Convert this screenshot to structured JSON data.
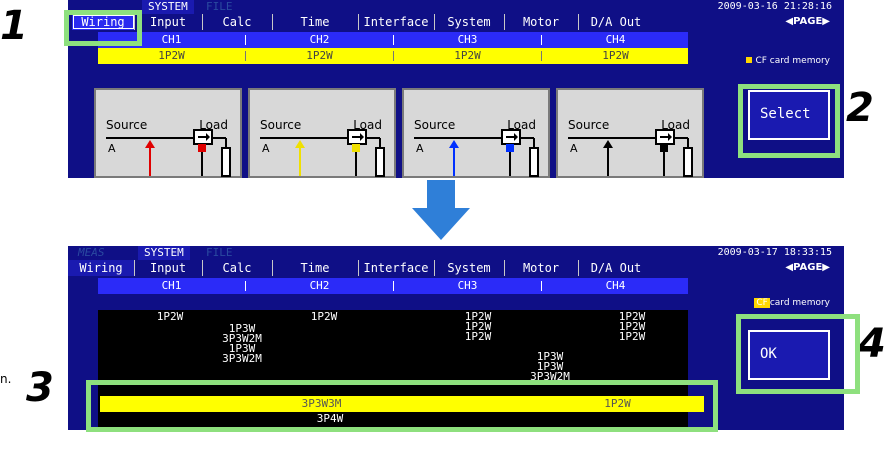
{
  "steps": [
    "1",
    "2",
    "3",
    "4"
  ],
  "screen1": {
    "menu_top": [
      "SYSTEM",
      "FILE"
    ],
    "datetime": "2009-03-16 21:28:16",
    "tabs": [
      "Wiring",
      "Input",
      "Calc",
      "Time",
      "Interface",
      "System",
      "Motor",
      "D/A Out"
    ],
    "page_label": "PAGE",
    "channels": [
      "CH1",
      "CH2",
      "CH3",
      "CH4"
    ],
    "wiring": [
      "1P2W",
      "1P2W",
      "1P2W",
      "1P2W"
    ],
    "cf_label": "CF card memory",
    "diagram_source": "Source",
    "diagram_load": "Load",
    "diagram_a": "A",
    "select_button": "Select"
  },
  "screen2": {
    "menu_top": [
      "MEAS",
      "SYSTEM",
      "FILE"
    ],
    "datetime": "2009-03-17 18:33:15",
    "tabs": [
      "Wiring",
      "Input",
      "Calc",
      "Time",
      "Interface",
      "System",
      "Motor",
      "D/A Out"
    ],
    "page_label": "PAGE",
    "channels": [
      "CH1",
      "CH2",
      "CH3",
      "CH4"
    ],
    "cf_label_prefix": "CF",
    "cf_label_rest": "card memory",
    "options": {
      "col1_top": "1P2W",
      "col2_top": "1P2W",
      "col3_lines": [
        "1P2W",
        "1P2W",
        "1P2W"
      ],
      "col4_lines": [
        "1P2W",
        "1P2W",
        "1P2W"
      ],
      "mid_a": [
        "1P3W",
        "3P3W2M",
        "1P3W",
        "3P3W2M"
      ],
      "mid_b": [
        "1P3W",
        "1P3W",
        "3P3W2M"
      ]
    },
    "highlight_row": [
      "",
      "3P3W3M",
      "",
      "1P2W"
    ],
    "below_row": "3P4W",
    "ok_button": "OK"
  },
  "side_text": "n."
}
